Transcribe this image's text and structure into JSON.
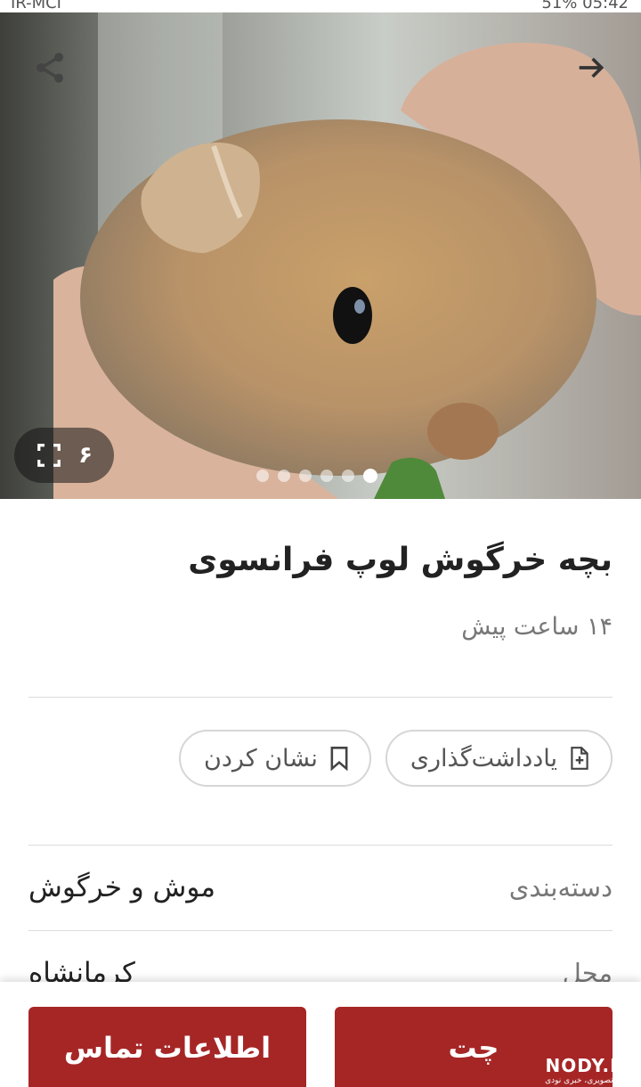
{
  "status_bar": {
    "carrier": "IR-MCI",
    "right_text": "51% 05:42"
  },
  "hero": {
    "image_count": "۶",
    "dots_total": 6,
    "dots_active_index": 5
  },
  "ad": {
    "title": "بچه خرگوش لوپ فرانسوی",
    "posted": "۱۴ ساعت پیش"
  },
  "actions": {
    "note_label": "یادداشت‌گذاری",
    "bookmark_label": "نشان کردن"
  },
  "details": [
    {
      "label": "دسته‌بندی",
      "value": "موش و خرگوش"
    },
    {
      "label": "محل",
      "value": "کرمانشاه"
    }
  ],
  "bottom_bar": {
    "chat_label": "چت",
    "contact_label": "اطلاعات تماس"
  },
  "watermark": {
    "main": "NODY.IR",
    "sub": "مجله تصویری، خبری نودی"
  },
  "colors": {
    "primary": "#a62626",
    "divider": "#dcdcdc",
    "muted_text": "#777777"
  }
}
